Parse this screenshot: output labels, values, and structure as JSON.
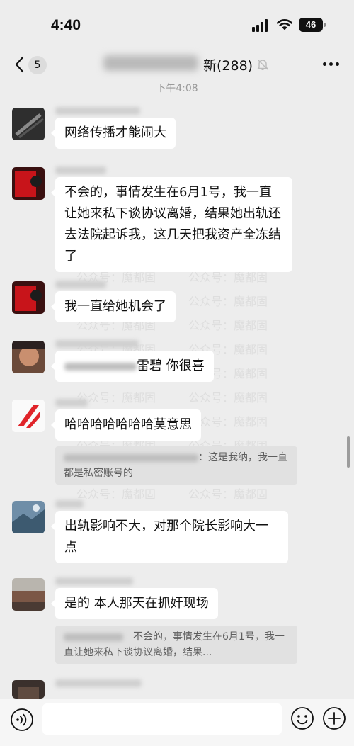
{
  "status_bar": {
    "time": "4:40",
    "battery": "46",
    "icons": [
      "signal-icon",
      "wifi-icon",
      "battery-icon"
    ]
  },
  "nav": {
    "back_count": "5",
    "title_suffix": "新(288)",
    "icons": [
      "back-icon",
      "mute-icon",
      "more-icon"
    ]
  },
  "chat": {
    "timestamp": "下午4:08",
    "watermark": "公众号：魔都固",
    "messages": [
      {
        "text": "网络传播才能闹大"
      },
      {
        "text": "不会的，事情发生在6月1号，我一直让她来私下谈协议离婚，结果她出轨还去法院起诉我，这几天把我资产全冻结了"
      },
      {
        "text": "我一直给她机会了"
      },
      {
        "text": "雷碧 你很喜"
      },
      {
        "text": "哈哈哈哈哈哈哈莫意思",
        "quote": "：这是我纳，我一直都是私密账号的"
      },
      {
        "text": "出轨影响不大，对那个院长影响大一点"
      },
      {
        "text": "是的 本人那天在抓奸现场",
        "quote": "不会的，事情发生在6月1号，我一直让她来私下谈协议离婚，结果..."
      }
    ]
  },
  "input_bar": {
    "placeholder": "",
    "icons": [
      "voice-icon",
      "emoji-icon",
      "plus-icon"
    ]
  },
  "colors": {
    "background": "#ededed",
    "bubble": "#ffffff",
    "quote_background": "#e1e1e1",
    "timestamp": "#9a9a9a"
  }
}
